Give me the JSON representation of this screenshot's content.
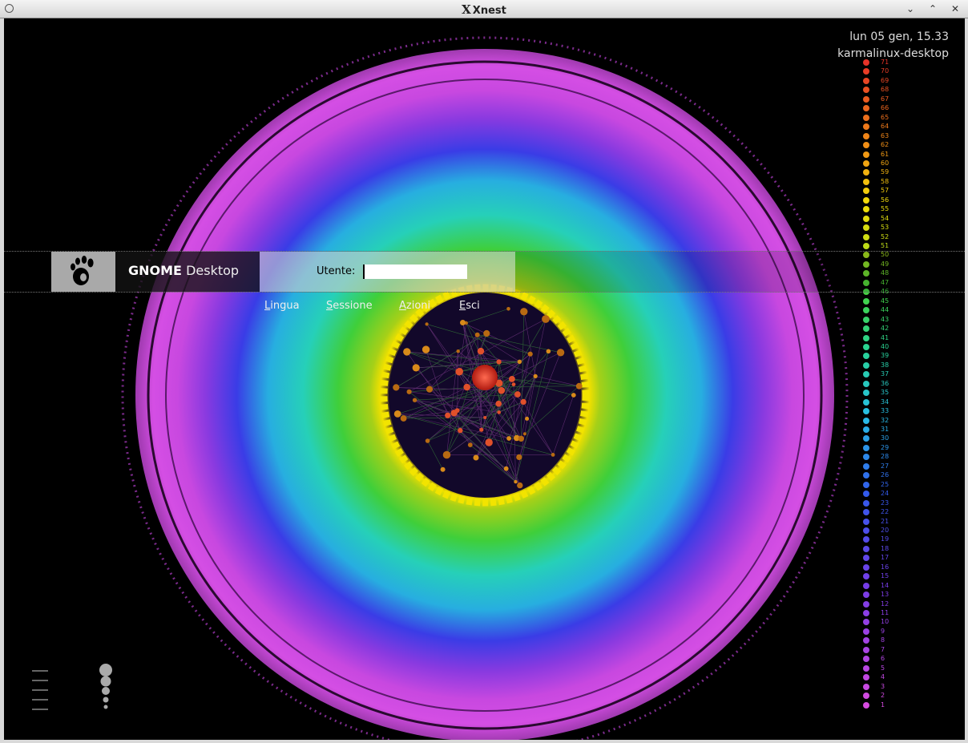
{
  "window": {
    "title": "Xnest"
  },
  "greeter": {
    "clock": "lun 05 gen, 15.33",
    "hostname": "karmalinux-desktop",
    "brand_bold": "GNOME",
    "brand_rest": " Desktop",
    "user_label": "Utente:",
    "user_value": "",
    "menu": [
      {
        "accel": "L",
        "rest": "ingua"
      },
      {
        "accel": "S",
        "rest": "essione"
      },
      {
        "accel": "A",
        "rest": "zioni"
      },
      {
        "accel": "E",
        "rest": "sci"
      }
    ]
  },
  "legend": {
    "min": 1,
    "max": 71
  },
  "colors": {
    "outer_ring": "#d64be0",
    "blue_band": "#3c3ce8",
    "cyan_band": "#2cc4d8",
    "green_band": "#44d63a",
    "yellow_ring": "#f2e400",
    "core": "#e23a2a"
  }
}
